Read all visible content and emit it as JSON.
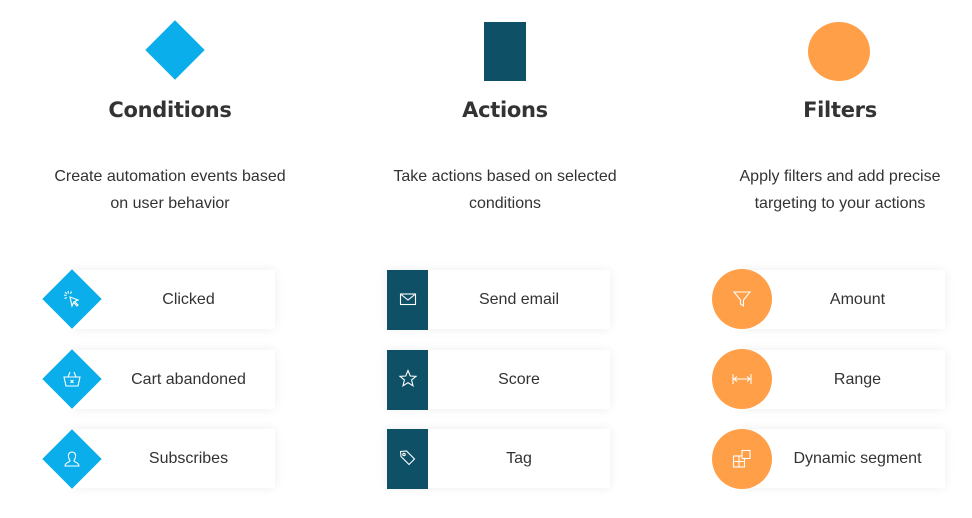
{
  "colors": {
    "conditions": "#0aaeea",
    "actions": "#0e5066",
    "filters": "#ff9f48",
    "text": "#333333"
  },
  "columns": [
    {
      "id": "conditions",
      "shape": "diamond",
      "title": "Conditions",
      "description": [
        "Create automation events based",
        "on user behavior"
      ],
      "items": [
        {
          "label": "Clicked",
          "icon": "cursor-click-icon"
        },
        {
          "label": "Cart abandoned",
          "icon": "basket-x-icon"
        },
        {
          "label": "Subscribes",
          "icon": "user-icon"
        }
      ]
    },
    {
      "id": "actions",
      "shape": "rectangle",
      "title": "Actions",
      "description": [
        "Take actions based on selected",
        "conditions"
      ],
      "items": [
        {
          "label": "Send email",
          "icon": "envelope-icon"
        },
        {
          "label": "Score",
          "icon": "star-icon"
        },
        {
          "label": "Tag",
          "icon": "tag-icon"
        }
      ]
    },
    {
      "id": "filters",
      "shape": "circle",
      "title": "Filters",
      "description": [
        "Apply filters and add precise",
        "targeting to your actions"
      ],
      "items": [
        {
          "label": "Amount",
          "icon": "funnel-icon"
        },
        {
          "label": "Range",
          "icon": "range-arrows-icon"
        },
        {
          "label": "Dynamic segment",
          "icon": "segment-blocks-icon"
        }
      ]
    }
  ]
}
